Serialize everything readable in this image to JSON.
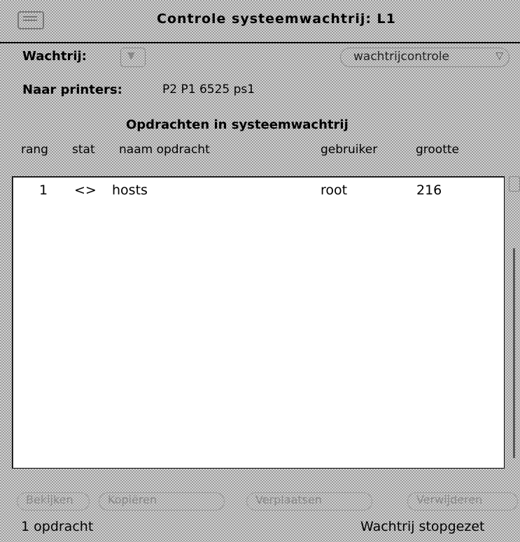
{
  "window": {
    "title": "Controle systeemwachtrij: L1",
    "menu_icon": "window-menu-icon"
  },
  "queue": {
    "label": "Wachtrij:",
    "abbrev_menu_icon": "chevron-down-icon",
    "control_menu_label": "wachtrijcontrole",
    "control_menu_icon": "chevron-down-icon"
  },
  "printers": {
    "label": "Naar printers:",
    "value": "P2 P1 6525 ps1"
  },
  "jobs": {
    "heading": "Opdrachten in systeemwachtrij",
    "columns": {
      "rank": "rang",
      "status": "stat",
      "name": "naam opdracht",
      "user": "gebruiker",
      "size": "grootte"
    },
    "rows": [
      {
        "rank": "1",
        "status": "<>",
        "name": "hosts",
        "user": "root",
        "size": "216"
      }
    ]
  },
  "buttons": {
    "view": "Bekijken",
    "copy": "Kopiëren",
    "move": "Verplaatsen",
    "delete": "Verwijderen"
  },
  "status": {
    "count": "1 opdracht",
    "state": "Wachtrij stopgezet"
  }
}
